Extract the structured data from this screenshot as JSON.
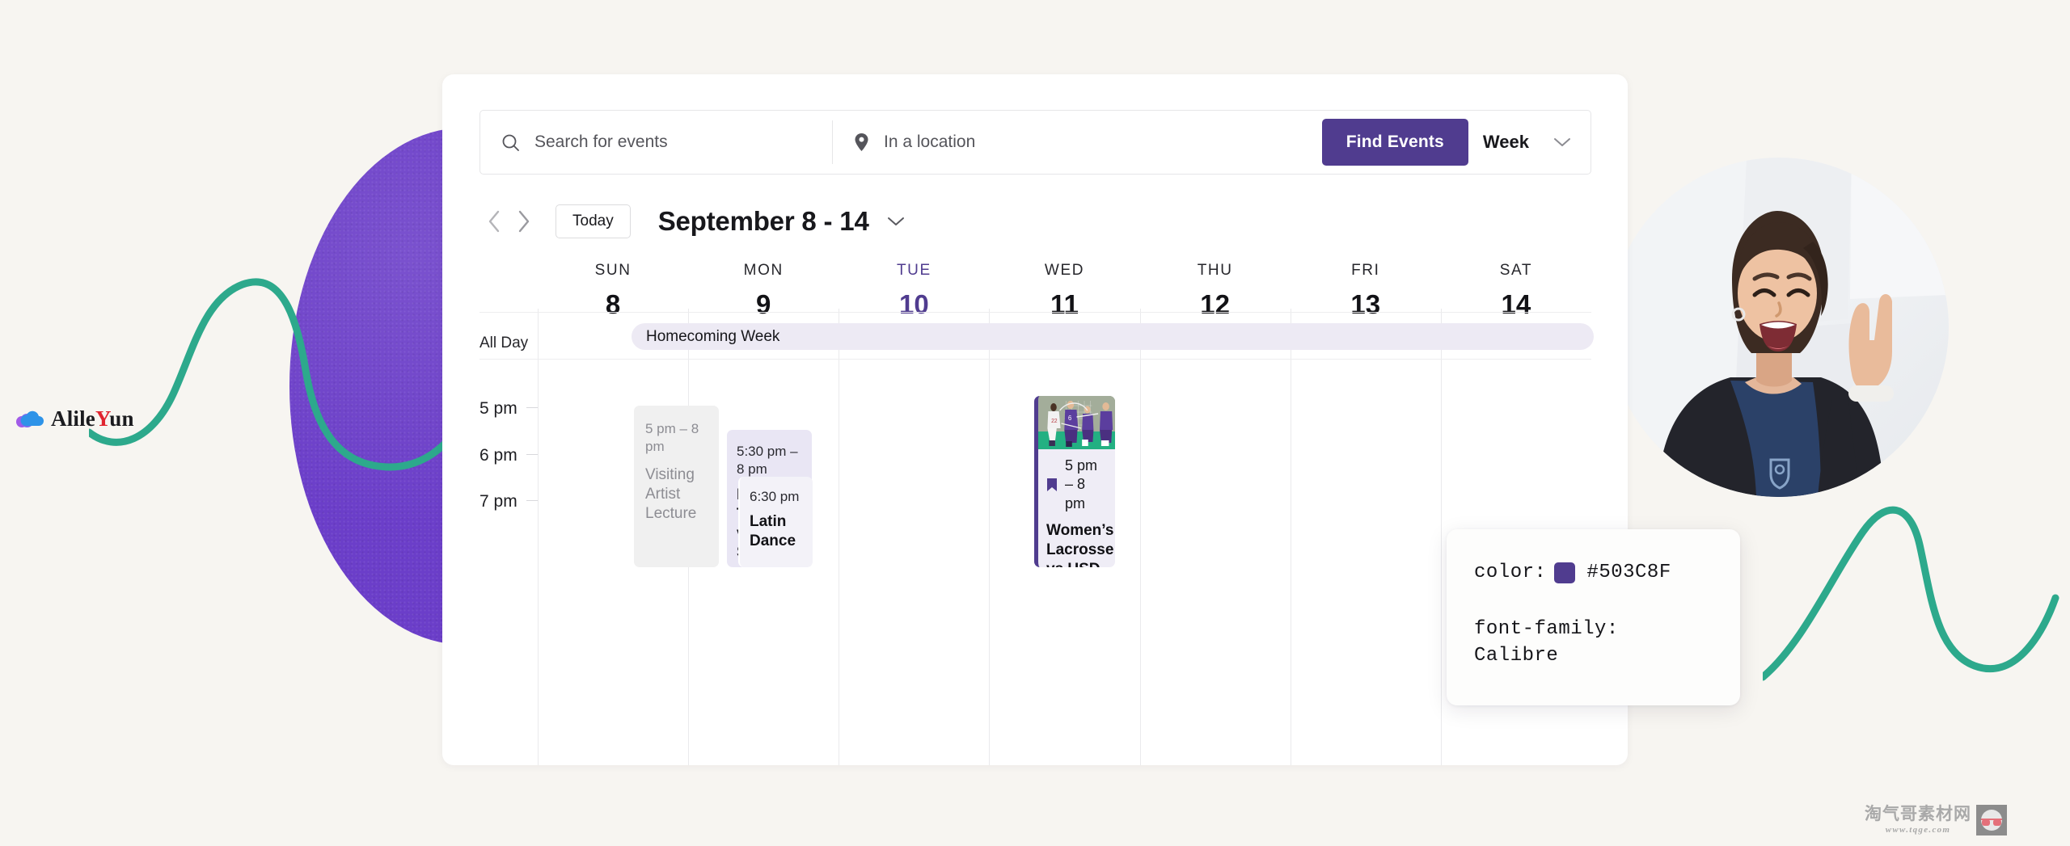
{
  "brand": {
    "logo_text_prefix": "Alile",
    "logo_text_accent": "Y",
    "logo_text_suffix": "un",
    "logo_icon": "cloud-icon"
  },
  "search": {
    "events_placeholder": "Search for events",
    "location_placeholder": "In a location",
    "search_icon": "search-icon",
    "pin_icon": "location-pin-icon",
    "find_button": "Find Events",
    "view_label": "Week",
    "view_chevron": "chevron-down-icon"
  },
  "datenav": {
    "prev_icon": "chevron-left-icon",
    "next_icon": "chevron-right-icon",
    "today_label": "Today",
    "range_title": "September 8 - 14",
    "range_chevron": "chevron-down-icon"
  },
  "calendar": {
    "all_day_label": "All Day",
    "days": [
      {
        "name": "SUN",
        "num": "8",
        "today": false
      },
      {
        "name": "MON",
        "num": "9",
        "today": false
      },
      {
        "name": "TUE",
        "num": "10",
        "today": true
      },
      {
        "name": "WED",
        "num": "11",
        "today": false
      },
      {
        "name": "THU",
        "num": "12",
        "today": false
      },
      {
        "name": "FRI",
        "num": "13",
        "today": false
      },
      {
        "name": "SAT",
        "num": "14",
        "today": false
      }
    ],
    "hours": [
      "5 pm",
      "6 pm",
      "7 pm"
    ],
    "all_day_event": {
      "title": "Homecoming Week",
      "start_day": "MON",
      "end_day": "SAT"
    },
    "events": [
      {
        "id": "visiting-artist-lecture",
        "day": "MON",
        "time": "5 pm – 8 pm",
        "title": "Visiting Artist Lecture",
        "style": "grey"
      },
      {
        "id": "mens-tennis-vs-penn-state",
        "day": "TUE",
        "time": "5:30 pm – 8 pm",
        "title": "Men’s Tennis vs Penn State",
        "style": "lavender"
      },
      {
        "id": "latin-dance",
        "day": "TUE",
        "time": "6:30 pm",
        "title": "Latin Dance",
        "style": "nested"
      },
      {
        "id": "womens-lacrosse-vs-usd",
        "day": "THU",
        "time": "5 pm – 8 pm",
        "title": "Women’s Lacrosse vs USD",
        "style": "photo",
        "has_thumbnail": true,
        "bookmark_icon": "bookmark-icon"
      }
    ]
  },
  "tooltip": {
    "color_prop": "color:",
    "color_value": "#503C8F",
    "swatch_hex": "#503C8F",
    "font_prop": "font-family:",
    "font_value": "Calibre"
  },
  "photo": {
    "alt": "smiling-student-peace-sign"
  },
  "watermark": {
    "cn": "淘气哥素材网",
    "url": "www.tqge.com",
    "badge_icon": "glasses-icon"
  },
  "colors": {
    "brand_purple": "#503C8F",
    "blob_purple": "#6A3FC3",
    "teal": "#2DA98C",
    "page_bg": "#F7F5F1",
    "lavender_event": "#E9E6F4",
    "allday_bar": "#EDEAF4"
  }
}
